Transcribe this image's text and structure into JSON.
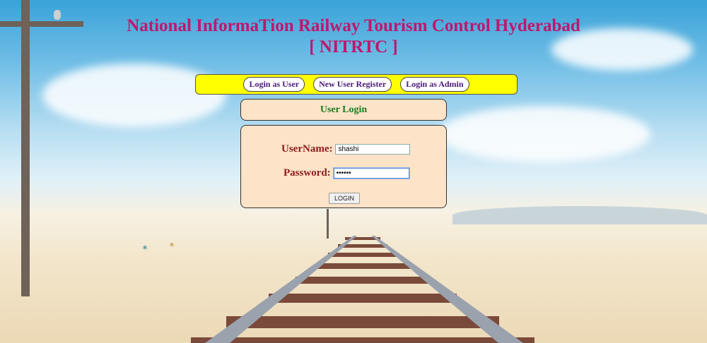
{
  "header": {
    "title_line1": "National InformaTion Railway Tourism Control Hyderabad",
    "title_line2": "[ NITRTC ]"
  },
  "nav": {
    "login_user": "Login as User",
    "register": "New User Register",
    "login_admin": "Login as Admin"
  },
  "login": {
    "panel_title": "User Login",
    "username_label": "UserName:",
    "username_value": "shashi",
    "password_label": "Password:",
    "password_value": "••••••",
    "submit_label": "LOGIN"
  },
  "colors": {
    "title": "#c0166e",
    "nav_bar": "#ffff00",
    "panel_bg": "#fde3c8",
    "panel_title_text": "#1e7a1e",
    "label_text": "#8b1c1c"
  }
}
